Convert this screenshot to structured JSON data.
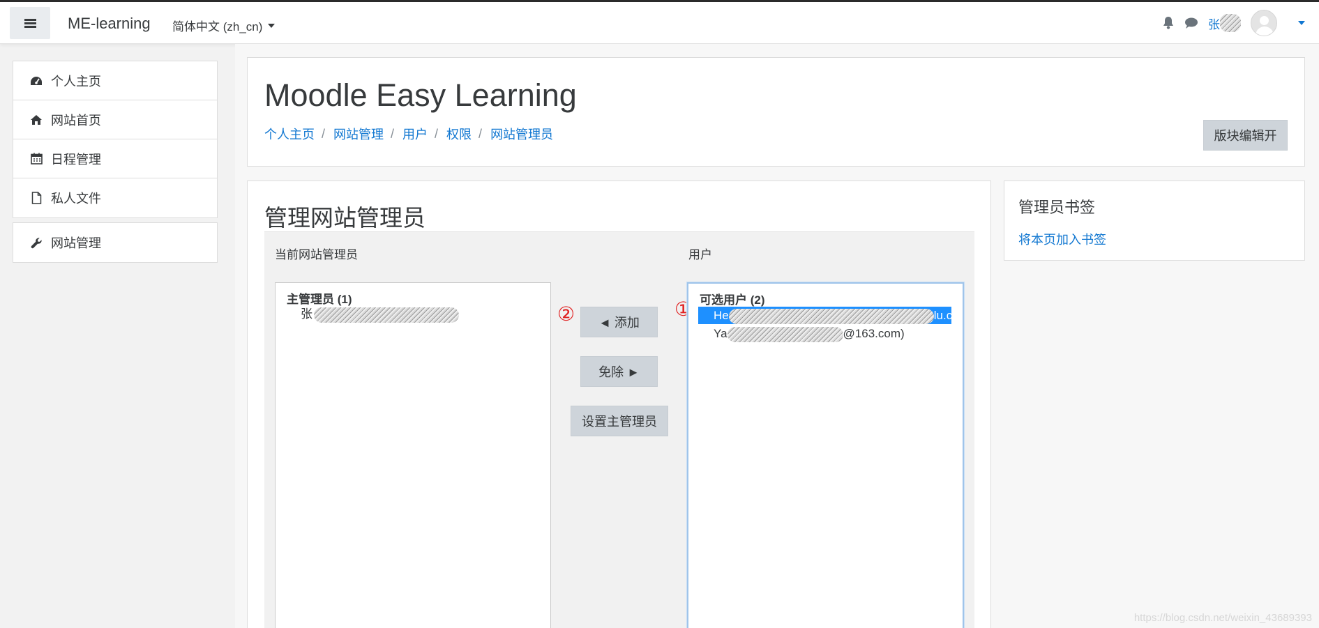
{
  "navbar": {
    "brand": "ME-learning",
    "language": "简体中文 (zh_cn)",
    "user_name": "张"
  },
  "left_nav": {
    "group1": [
      {
        "label": "个人主页",
        "icon": "dashboard-icon"
      },
      {
        "label": "网站首页",
        "icon": "home-icon"
      },
      {
        "label": "日程管理",
        "icon": "calendar-icon"
      },
      {
        "label": "私人文件",
        "icon": "file-icon"
      }
    ],
    "group2": [
      {
        "label": "网站管理",
        "icon": "wrench-icon"
      }
    ]
  },
  "header": {
    "site_title": "Moodle Easy Learning",
    "breadcrumb": [
      "个人主页",
      "网站管理",
      "用户",
      "权限",
      "网站管理员"
    ],
    "edit_button": "版块编辑开"
  },
  "content": {
    "heading": "管理网站管理员",
    "current_admins_label": "当前网站管理员",
    "current_admins_group": "主管理员 (1)",
    "current_admins": [
      "张"
    ],
    "users_label": "用户",
    "users_group": "可选用户 (2)",
    "users": [
      "He",
      "lu.c",
      "Ya",
      "@163.com)"
    ],
    "add_button": "◄ 添加",
    "remove_button": "免除 ►",
    "main_admin_button": "设置主管理员",
    "markers": [
      "①",
      "②"
    ]
  },
  "sidebar_block": {
    "title": "管理员书签",
    "link": "将本页加入书签"
  },
  "watermark": "https://blog.csdn.net/weixin_43689393",
  "colors": {
    "link": "#1177d1",
    "selection": "#1e90ff",
    "button": "#ced4da",
    "marker": "#e02020"
  }
}
